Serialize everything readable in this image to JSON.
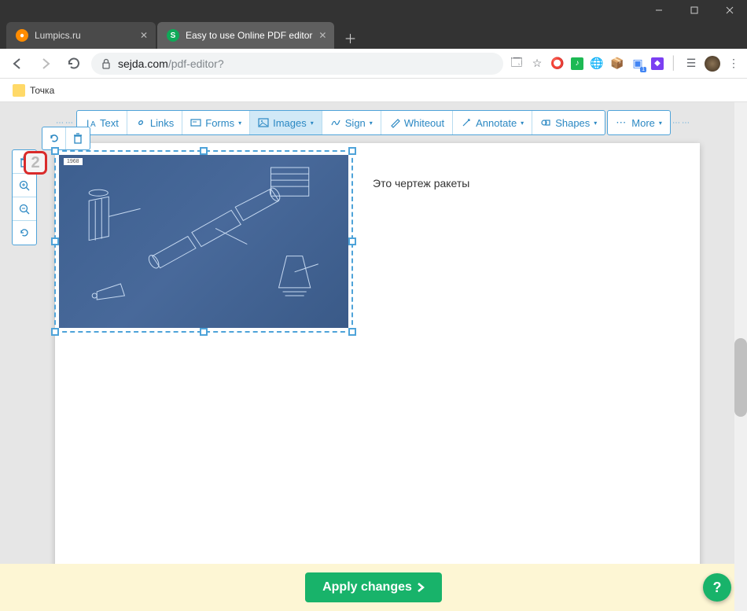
{
  "window": {
    "tabs": [
      {
        "title": "Lumpics.ru",
        "active": false
      },
      {
        "title": "Easy to use Online PDF editor",
        "active": true
      }
    ],
    "url_host": "sejda.com",
    "url_path": "/pdf-editor?"
  },
  "bookmarks": [
    {
      "label": "Точка"
    }
  ],
  "toolbar": [
    {
      "label": "Text",
      "icon": "text",
      "caret": false
    },
    {
      "label": "Links",
      "icon": "link",
      "caret": false
    },
    {
      "label": "Forms",
      "icon": "form",
      "caret": true
    },
    {
      "label": "Images",
      "icon": "image",
      "caret": true,
      "active": true
    },
    {
      "label": "Sign",
      "icon": "sign",
      "caret": true
    },
    {
      "label": "Whiteout",
      "icon": "whiteout",
      "caret": false
    },
    {
      "label": "Annotate",
      "icon": "annotate",
      "caret": true
    },
    {
      "label": "Shapes",
      "icon": "shapes",
      "caret": true
    },
    {
      "label": "More",
      "icon": "more",
      "caret": true
    }
  ],
  "page": {
    "number": "2",
    "text": "Это чертеж ракеты",
    "image_label": "1968"
  },
  "actions": {
    "apply": "Apply changes"
  }
}
